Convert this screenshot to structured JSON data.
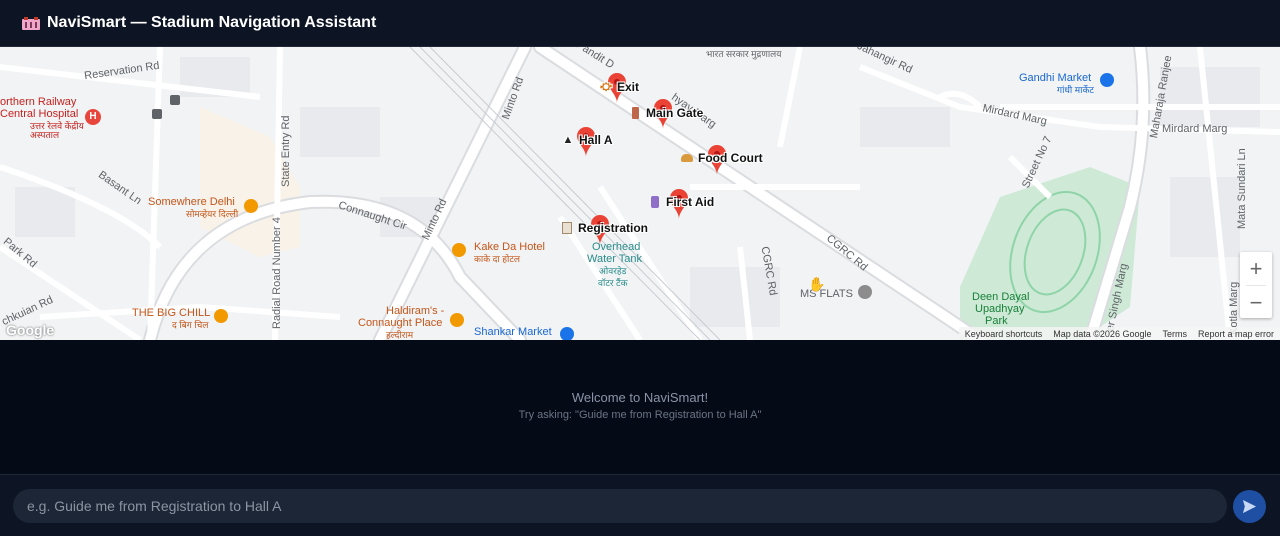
{
  "app": {
    "title": "NaviSmart — Stadium Navigation Assistant",
    "logo_icon": "stadium-icon"
  },
  "map": {
    "street_labels": {
      "reservation_rd": "Reservation Rd",
      "state_entry_rd": "State Entry Rd",
      "minto_rd_top": "Minto Rd",
      "minto_rd_bottom": "Minto Rd",
      "pandit": "Pandit D",
      "pandit_cont": "hyay Marg",
      "jahangir_rd": "Jahangir Rd",
      "basant_ln": "Basant Ln",
      "connaught_cir": "Connaught Cir",
      "radial_road": "Radial Road Number 4",
      "park_rd": "Park Rd",
      "chkuian_rd": "chkuian Rd",
      "mirdard_marg_1": "Mirdard Marg",
      "mirdard_marg_2": "Mirdard Marg",
      "street_no7": "Street No 7",
      "maharaja_ranjeet": "Maharaja Ranjee",
      "mata_sundari": "Mata Sundari Ln",
      "cgrc_rd_1": "CGRC Rd",
      "cgrc_rd_2": "CGRC Rd",
      "singh_marg": "er Singh Marg",
      "kotla_marg": "Kotla Marg",
      "bharat_sarkar": "भारत सरकार मुद्रणालय"
    },
    "places": {
      "northern_railway": "orthern Railway",
      "central_hospital": "Central Hospital",
      "hospital_hindi": "उत्तर रेलवे केंद्रीय अस्पताल",
      "somewhere_delhi": "Somewhere Delhi",
      "somewhere_hindi": "सोमव्हेयर दिल्ली",
      "kake_da_hotel": "Kake Da Hotel",
      "kake_hindi": "काके दा होटल",
      "overhead_tank": "Overhead",
      "overhead_tank2": "Water Tank",
      "overhead_hindi": "ओवरहेड",
      "overhead_hindi2": "वॉटर टैंक",
      "the_big_chill": "THE BIG CHILL",
      "big_chill_hindi": "द बिग चिल",
      "haldirams": "Haldiram's -",
      "haldirams2": "Connaught Place",
      "haldirams_hindi": "हल्दीराम",
      "shankar_market": "Shankar Market",
      "gandhi_market": "Gandhi Market",
      "gandhi_hindi": "गांधी मार्केट",
      "ms_flats": "MS FLATS",
      "deen_dayal": "Deen Dayal",
      "upadhyay": "Upadhyay",
      "park": "Park"
    },
    "markers": [
      {
        "label": "Exit",
        "icon": "running-person-icon"
      },
      {
        "label": "Main Gate",
        "icon": "door-icon"
      },
      {
        "label": "Hall A",
        "icon": "graduation-cap-icon"
      },
      {
        "label": "Food Court",
        "icon": "burger-icon"
      },
      {
        "label": "First Aid",
        "icon": "medicine-icon"
      },
      {
        "label": "Registration",
        "icon": "clipboard-icon"
      }
    ],
    "zoom_in": "+",
    "zoom_out": "−",
    "google_logo": "Google",
    "attribution": {
      "shortcuts": "Keyboard shortcuts",
      "data": "Map data ©2026 Google",
      "terms": "Terms",
      "report": "Report a map error"
    }
  },
  "chat": {
    "welcome": "Welcome to NaviSmart!",
    "hint": "Try asking: \"Guide me from Registration to Hall A\""
  },
  "input": {
    "placeholder": "e.g. Guide me from Registration to Hall A",
    "value": "",
    "send_icon": "send-icon"
  },
  "colors": {
    "header_bg": "#0d1424",
    "page_bg": "#050b16",
    "marker_red": "#ea4335",
    "send_button": "#1e4fa3"
  }
}
